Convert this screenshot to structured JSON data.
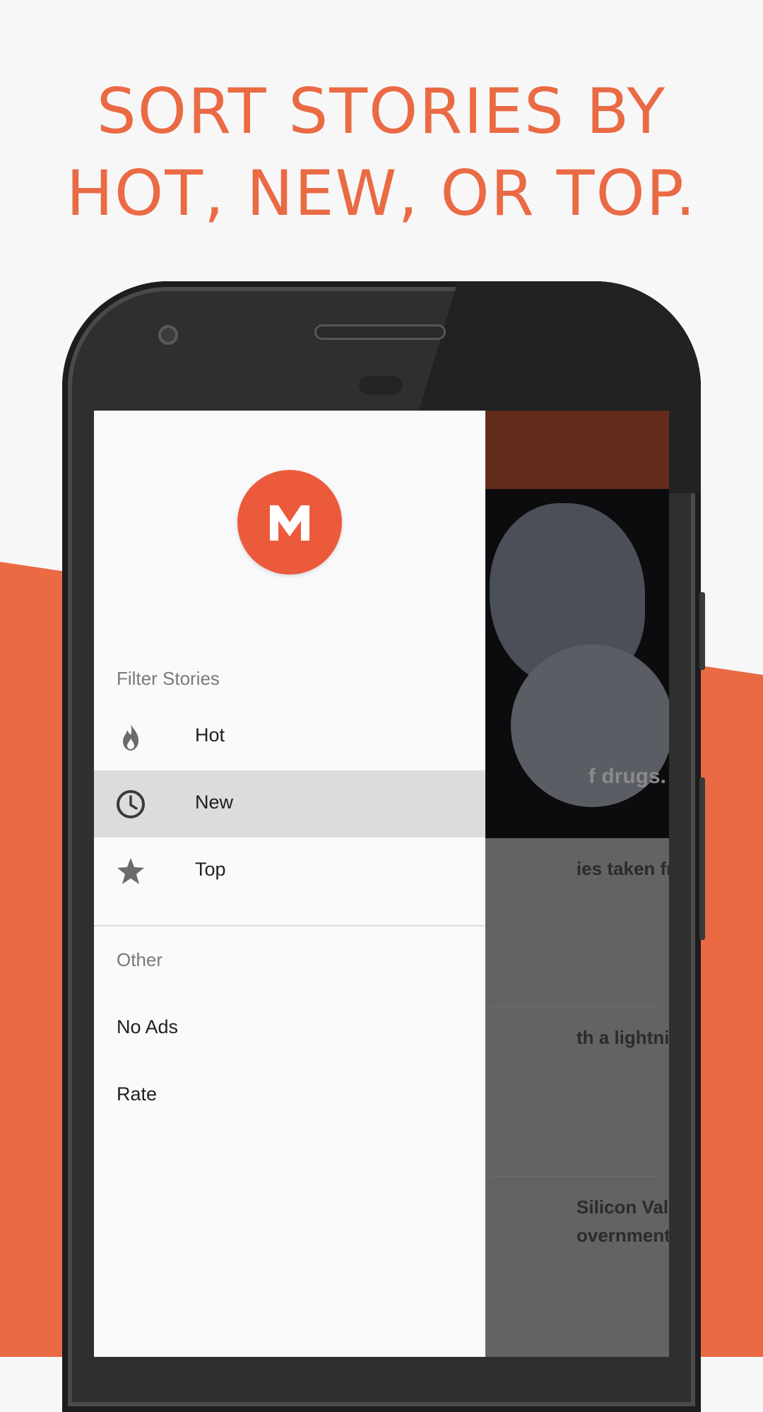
{
  "headline": {
    "line1": "SORT STORIES BY",
    "line2": "HOT, NEW, OR TOP."
  },
  "colors": {
    "accent": "#ea6a44",
    "logo": "#ec5a3c",
    "app_bar": "#622b1c",
    "selected_row": "#dcdcdc"
  },
  "app": {
    "logo_icon": "medium-m-logo",
    "logo_letter": "M"
  },
  "drawer": {
    "filter_title": "Filter Stories",
    "filters": [
      {
        "label": "Hot",
        "icon": "flame-icon",
        "selected": false
      },
      {
        "label": "New",
        "icon": "clock-icon",
        "selected": true
      },
      {
        "label": "Top",
        "icon": "star-icon",
        "selected": false
      }
    ],
    "other_title": "Other",
    "other": [
      {
        "label": "No Ads"
      },
      {
        "label": "Rate"
      }
    ]
  },
  "background_feed": {
    "hero_caption_fragment": "f drugs.",
    "stories": [
      {
        "line1": "ies taken from",
        "line2": ""
      },
      {
        "line1": "th a lightning rod’",
        "line2": ""
      },
      {
        "line1": "Silicon Valley",
        "line2": "overnment to giv…"
      }
    ]
  }
}
